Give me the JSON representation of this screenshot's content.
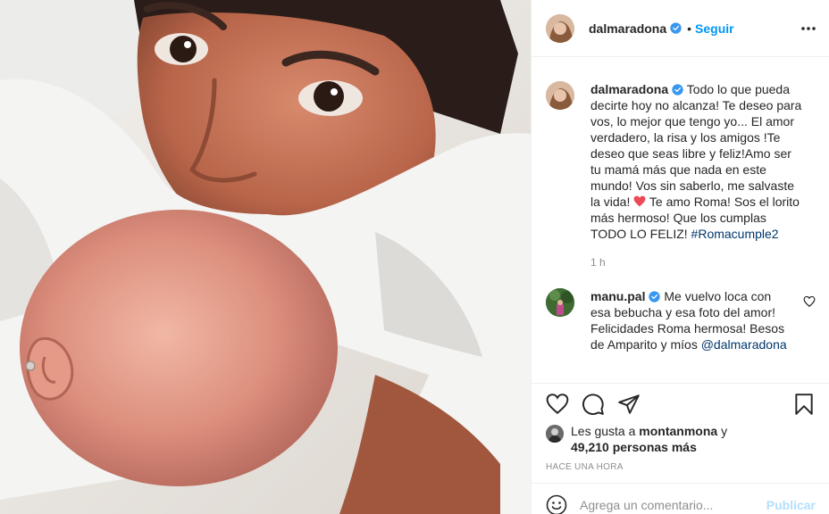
{
  "post": {
    "author": "dalmaradona",
    "follow_label": "Seguir",
    "separator": "•",
    "image_alt": "Foto de una mujer besando la cabeza de una bebé"
  },
  "caption": {
    "username": "dalmaradona",
    "text": "Todo lo que pueda decirte hoy no alcanza! Te deseo para vos, lo mejor que tengo yo... El amor verdadero, la risa y los amigos !Te deseo que seas libre y feliz!Amo ser tu mamá más que nada en este mundo! Vos sin saberlo, me salvaste la vida!",
    "text_after_heart": "Te amo Roma! Sos el lorito más hermoso! Que los cumplas TODO LO FELIZ!",
    "hashtag": "#Romacumple2",
    "time": "1 h"
  },
  "comment1": {
    "username": "manu.pal",
    "text": "Me vuelvo loca con esa bebucha y esa foto del amor! Felicidades Roma hermosa! Besos de Amparito y míos",
    "mention": "@dalmaradona"
  },
  "likes": {
    "prefix": "Les gusta a",
    "user": "montanmona",
    "connector": "y",
    "count": "49,210 personas más"
  },
  "posted_ago": "HACE UNA HORA",
  "add_comment": {
    "placeholder": "Agrega un comentario...",
    "publish_label": "Publicar"
  },
  "colors": {
    "accent": "#0095f6",
    "verified": "#3897f0",
    "heart": "#ed4956",
    "publish_disabled": "#b2dffc"
  },
  "icons": {
    "more": "more-options-icon",
    "like": "heart-icon",
    "comment": "comment-icon",
    "share": "share-icon",
    "save": "bookmark-icon",
    "emoji": "emoji-icon",
    "verified": "verified-badge-icon"
  }
}
